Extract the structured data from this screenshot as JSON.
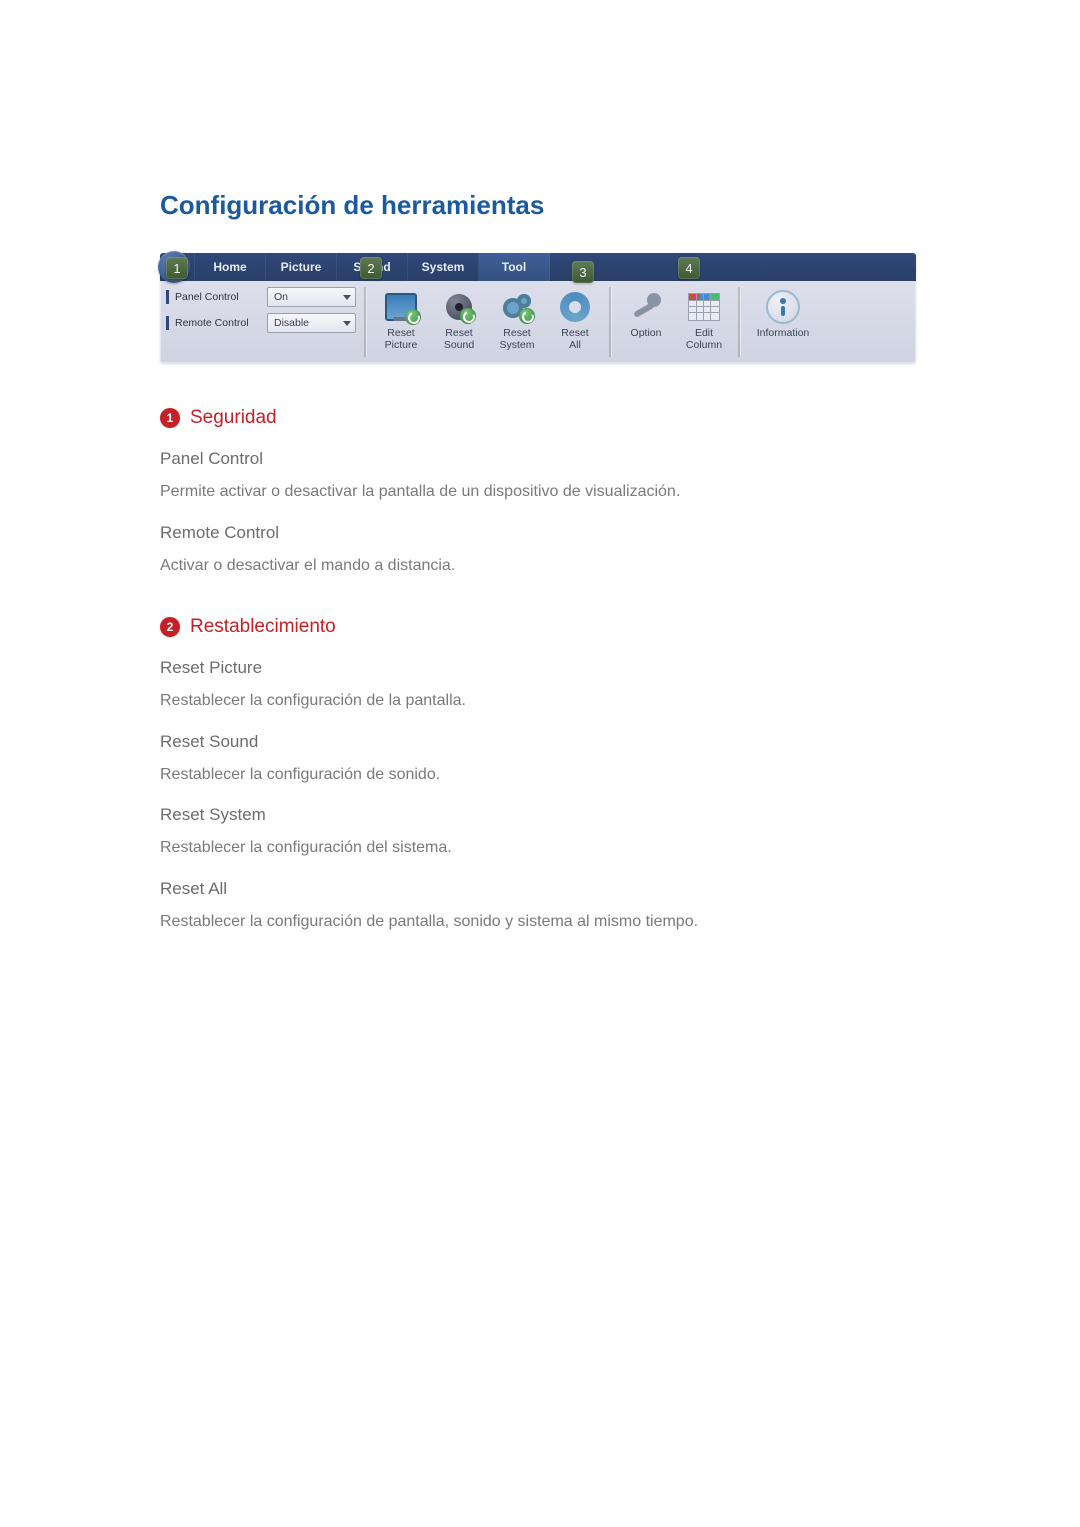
{
  "page_title": "Configuración de herramientas",
  "toolbar": {
    "tabs": {
      "home": "Home",
      "picture": "Picture",
      "sound": "Sound",
      "system": "System",
      "tool": "Tool"
    },
    "security": {
      "panel_control_label": "Panel Control",
      "panel_control_value": "On",
      "remote_control_label": "Remote Control",
      "remote_control_value": "Disable"
    },
    "reset": {
      "picture": {
        "l1": "Reset",
        "l2": "Picture"
      },
      "sound": {
        "l1": "Reset",
        "l2": "Sound"
      },
      "system": {
        "l1": "Reset",
        "l2": "System"
      },
      "all": {
        "l1": "Reset",
        "l2": "All"
      }
    },
    "options": {
      "option_label": "Option",
      "edit_l1": "Edit",
      "edit_l2": "Column"
    },
    "info_label": "Information",
    "callouts": {
      "c1": "1",
      "c2": "2",
      "c3": "3",
      "c4": "4"
    }
  },
  "sections": {
    "s1": {
      "num": "1",
      "title": "Seguridad",
      "items": {
        "panel": {
          "head": "Panel Control",
          "body": "Permite activar o desactivar la pantalla de un dispositivo de visualización."
        },
        "remote": {
          "head": "Remote Control",
          "body": "Activar o desactivar el mando a distancia."
        }
      }
    },
    "s2": {
      "num": "2",
      "title": "Restablecimiento",
      "items": {
        "rp": {
          "head": "Reset Picture",
          "body": "Restablecer la configuración de la pantalla."
        },
        "rs": {
          "head": "Reset Sound",
          "body": "Restablecer la configuración de sonido."
        },
        "ry": {
          "head": "Reset System",
          "body": "Restablecer la configuración del sistema."
        },
        "ra": {
          "head": "Reset All",
          "body": "Restablecer la configuración de pantalla, sonido y sistema al mismo tiempo."
        }
      }
    }
  }
}
